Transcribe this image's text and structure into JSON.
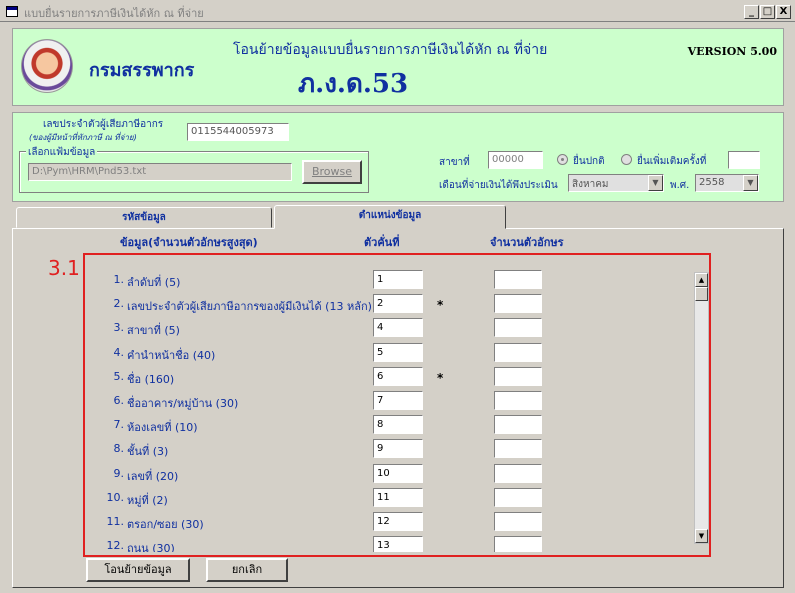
{
  "window": {
    "title": "แบบยื่นรายการภาษีเงินได้หัก ณ ที่จ่าย",
    "minimize": "_",
    "maximize": "□",
    "close": "X"
  },
  "header": {
    "department": "กรมสรรพากร",
    "title": "โอนย้ายข้อมูลแบบยื่นรายการภาษีเงินได้หัก ณ ที่จ่าย",
    "form_code": "ภ.ง.ด.53",
    "version": "VERSION 5.00"
  },
  "filter": {
    "tax_id_label": "เลขประจำตัวผู้เสียภาษีอากร",
    "tax_id_sublabel": "(ของผู้มีหน้าที่หักภาษี ณ ที่จ่าย)",
    "tax_id_value": "0115544005973",
    "file_group_label": "เลือกแฟ้มข้อมูล",
    "file_path": "D:\\Pym\\HRM\\Pnd53.txt",
    "browse_label": "Browse",
    "branch_label": "สาขาที่",
    "branch_value": "00000",
    "radio_normal": "ยื่นปกติ",
    "radio_additional": "ยื่นเพิ่มเติมครั้งที่",
    "additional_value": "",
    "pay_month_label": "เดือนที่จ่ายเงินได้พึงประเมิน",
    "month_value": "สิงหาคม",
    "year_label": "พ.ศ.",
    "year_value": "2558"
  },
  "tabs": [
    {
      "label": "รหัสข้อมูล"
    },
    {
      "label": "ตำแหน่งข้อมูล"
    }
  ],
  "columns": {
    "data": "ข้อมูล(จำนวนตัวอักษรสูงสุด)",
    "position": "ตัวคั่นที่",
    "length": "จำนวนตัวอักษร"
  },
  "annotation": {
    "label": "3.1",
    "color": "#e02020"
  },
  "rows": [
    {
      "num": "1.",
      "desc": "ลำดับที่ (5)",
      "pos": "1",
      "star": ""
    },
    {
      "num": "2.",
      "desc": "เลขประจำตัวผู้เสียภาษีอากรของผู้มีเงินได้ (13 หลัก)",
      "pos": "2",
      "star": "*"
    },
    {
      "num": "3.",
      "desc": "สาขาที่ (5)",
      "pos": "4",
      "star": ""
    },
    {
      "num": "4.",
      "desc": "คำนำหน้าชื่อ (40)",
      "pos": "5",
      "star": ""
    },
    {
      "num": "5.",
      "desc": "ชื่อ (160)",
      "pos": "6",
      "star": "*"
    },
    {
      "num": "6.",
      "desc": "ชื่ออาคาร/หมู่บ้าน (30)",
      "pos": "7",
      "star": ""
    },
    {
      "num": "7.",
      "desc": "ห้องเลขที่ (10)",
      "pos": "8",
      "star": ""
    },
    {
      "num": "8.",
      "desc": "ชั้นที่ (3)",
      "pos": "9",
      "star": ""
    },
    {
      "num": "9.",
      "desc": "เลขที่ (20)",
      "pos": "10",
      "star": ""
    },
    {
      "num": "10.",
      "desc": "หมู่ที่ (2)",
      "pos": "11",
      "star": ""
    },
    {
      "num": "11.",
      "desc": "ตรอก/ซอย (30)",
      "pos": "12",
      "star": ""
    },
    {
      "num": "12.",
      "desc": "ถนน (30)",
      "pos": "13",
      "star": ""
    }
  ],
  "buttons": {
    "transfer": "โอนย้ายข้อมูล",
    "cancel": "ยกเลิก"
  }
}
